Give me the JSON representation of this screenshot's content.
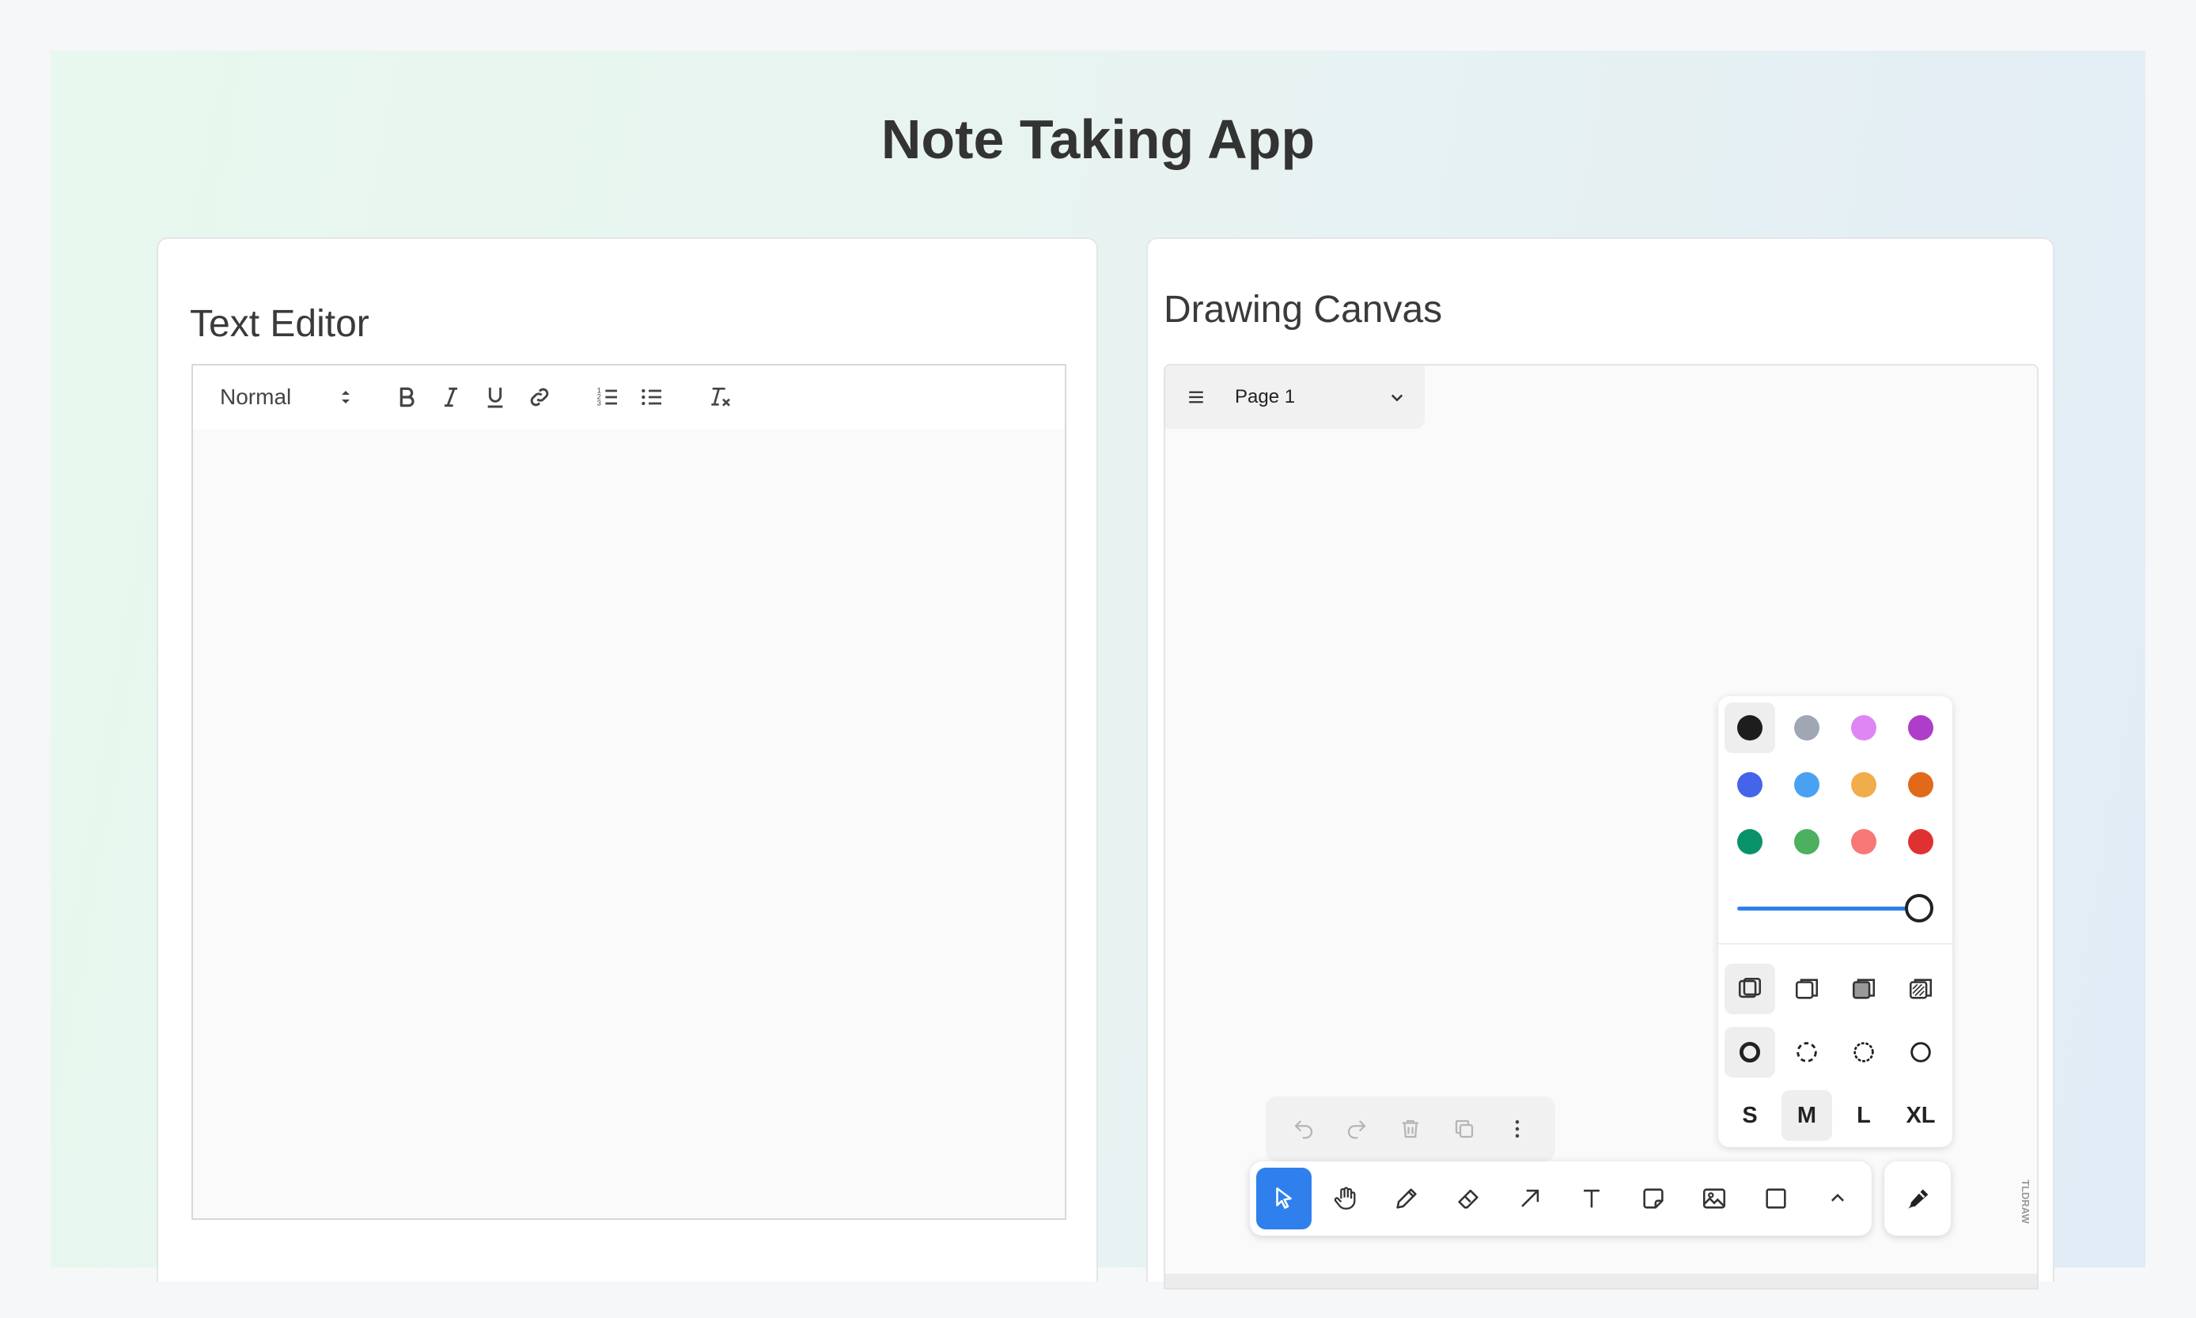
{
  "app": {
    "title": "Note Taking App"
  },
  "text_editor": {
    "heading": "Text Editor",
    "toolbar": {
      "format_select": "Normal",
      "buttons": [
        "bold",
        "italic",
        "underline",
        "link",
        "ordered-list",
        "bullet-list",
        "clear-format"
      ]
    },
    "content": ""
  },
  "drawing_canvas": {
    "heading": "Drawing Canvas",
    "page_menu": {
      "current_page": "Page 1"
    },
    "style_panel": {
      "colors": [
        {
          "name": "black",
          "hex": "#1d1d1d",
          "selected": true
        },
        {
          "name": "grey",
          "hex": "#9fa8b2"
        },
        {
          "name": "light-violet",
          "hex": "#e085f4"
        },
        {
          "name": "violet",
          "hex": "#ae3ec9"
        },
        {
          "name": "blue",
          "hex": "#4465e9"
        },
        {
          "name": "light-blue",
          "hex": "#4ba1f1"
        },
        {
          "name": "yellow",
          "hex": "#f1ac4b"
        },
        {
          "name": "orange",
          "hex": "#e16919"
        },
        {
          "name": "green",
          "hex": "#099268"
        },
        {
          "name": "light-green",
          "hex": "#4cb05e"
        },
        {
          "name": "light-red",
          "hex": "#f87777"
        },
        {
          "name": "red",
          "hex": "#e03131"
        }
      ],
      "opacity": 1.0,
      "fill_options": [
        "none",
        "semi",
        "solid",
        "pattern"
      ],
      "selected_fill": "none",
      "dash_options": [
        "draw",
        "dashed",
        "dotted",
        "solid"
      ],
      "selected_dash": "draw",
      "sizes": [
        "S",
        "M",
        "L",
        "XL"
      ],
      "selected_size": "M"
    },
    "actions": [
      "undo",
      "redo",
      "delete",
      "duplicate",
      "more"
    ],
    "tools": [
      "select",
      "hand",
      "draw",
      "eraser",
      "arrow",
      "text",
      "note",
      "asset",
      "rectangle",
      "more-tools"
    ],
    "selected_tool": "select",
    "watermark": "TLDRAW"
  },
  "colors": {
    "accent": "#2f80ed"
  }
}
